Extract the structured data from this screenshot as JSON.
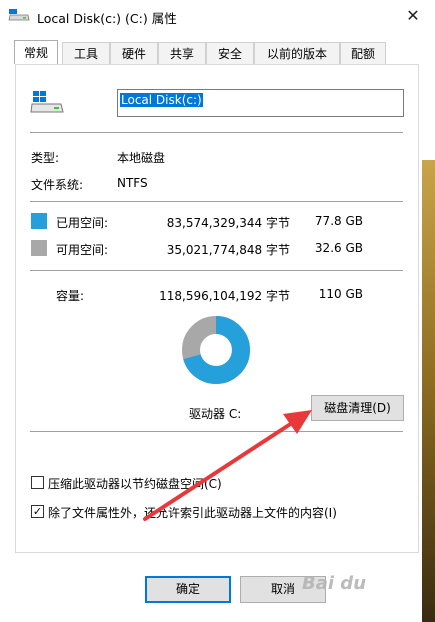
{
  "window": {
    "title": "Local Disk(c:) (C:) 属性",
    "close_glyph": "✕"
  },
  "tabs": [
    {
      "label": "常规"
    },
    {
      "label": "工具"
    },
    {
      "label": "硬件"
    },
    {
      "label": "共享"
    },
    {
      "label": "安全"
    },
    {
      "label": "以前的版本"
    },
    {
      "label": "配额"
    }
  ],
  "general": {
    "name_value": "Local Disk(c:)",
    "type_label": "类型:",
    "type_value": "本地磁盘",
    "fs_label": "文件系统:",
    "fs_value": "NTFS",
    "used_label": "已用空间:",
    "used_bytes": "83,574,329,344 字节",
    "used_gb": "77.8 GB",
    "free_label": "可用空间:",
    "free_bytes": "35,021,774,848 字节",
    "free_gb": "32.6 GB",
    "capacity_label": "容量:",
    "capacity_bytes": "118,596,104,192 字节",
    "capacity_gb": "110 GB",
    "drive_label": "驱动器 C:",
    "cleanup_button": "磁盘清理(D)",
    "used_fraction": 0.705,
    "compress_label": "压缩此驱动器以节约磁盘空间(C)",
    "compress_checked": false,
    "index_label": "除了文件属性外，还允许索引此驱动器上文件的内容(I)",
    "index_checked": true,
    "check_glyph": "✓"
  },
  "footer": {
    "ok": "确定",
    "cancel": "取消"
  },
  "watermark": "Bai du",
  "colors": {
    "used": "#26a0da",
    "free": "#a8a8a8",
    "accent": "#0078d7",
    "arrow": "#e8393a"
  }
}
